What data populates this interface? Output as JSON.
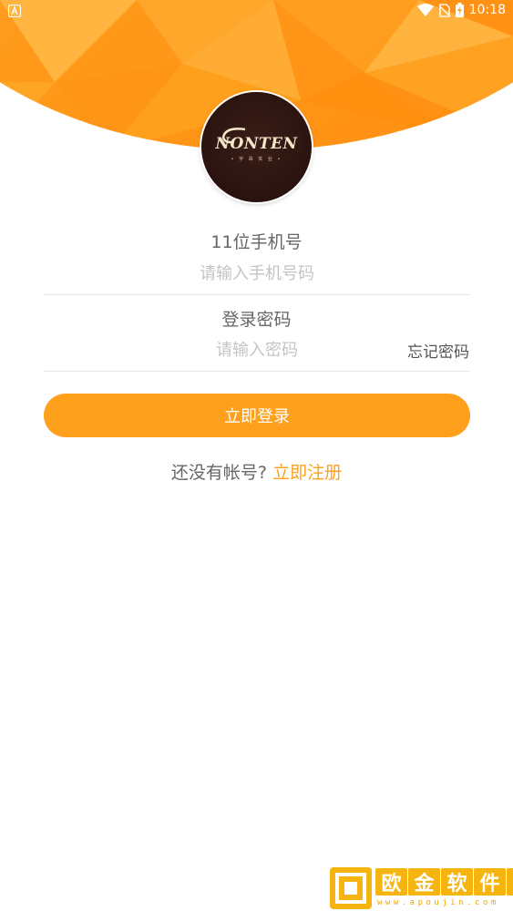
{
  "status_bar": {
    "time": "10:18",
    "icons": [
      "a-notification-icon",
      "wifi-icon",
      "no-sim-icon",
      "battery-charging-icon"
    ]
  },
  "logo": {
    "brand": "NONTEN",
    "subtitle": "• 宇 昂 实 业 •"
  },
  "form": {
    "phone_label": "11位手机号",
    "phone_placeholder": "请输入手机号码",
    "phone_value": "",
    "password_label": "登录密码",
    "password_placeholder": "请输入密码",
    "password_value": "",
    "forgot_password": "忘记密码",
    "login_button": "立即登录"
  },
  "register": {
    "prompt": "还没有帐号?",
    "link": "立即注册"
  },
  "watermark": {
    "title_chars": [
      "欧",
      "金",
      "软",
      "件",
      "园"
    ],
    "url": "www.apoujin.com"
  },
  "colors": {
    "accent": "#ffa01c",
    "header": "#ff9a1a",
    "logo_bg": "#2a130f"
  }
}
